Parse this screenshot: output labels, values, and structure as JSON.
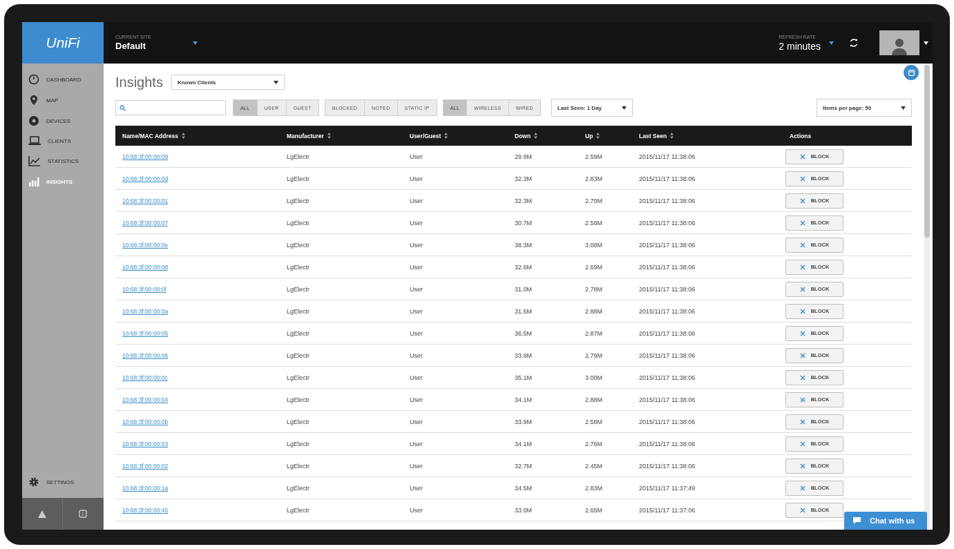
{
  "logo": {
    "text": "UniFi"
  },
  "header": {
    "site_label": "CURRENT SITE",
    "site_value": "Default",
    "refresh_label": "REFRESH RATE",
    "refresh_value": "2 minutes"
  },
  "sidebar": {
    "items": [
      {
        "label": "DASHBOARD",
        "kind": "dashboard",
        "selected": false
      },
      {
        "label": "MAP",
        "kind": "map",
        "selected": false
      },
      {
        "label": "DEVICES",
        "kind": "devices",
        "selected": false
      },
      {
        "label": "CLIENTS",
        "kind": "clients",
        "selected": false
      },
      {
        "label": "STATISTICS",
        "kind": "statistics",
        "selected": false
      },
      {
        "label": "INSIGHTS",
        "kind": "insights",
        "selected": true
      }
    ],
    "settings": "SETTINGS"
  },
  "page": {
    "title": "Insights",
    "view_select": "Known Clients"
  },
  "filters": {
    "groups": [
      [
        {
          "label": "ALL",
          "selected": true
        },
        {
          "label": "USER",
          "selected": false
        },
        {
          "label": "GUEST",
          "selected": false
        }
      ],
      [
        {
          "label": "BLOCKED",
          "selected": false
        },
        {
          "label": "NOTED",
          "selected": false
        },
        {
          "label": "STATIC IP",
          "selected": false
        }
      ],
      [
        {
          "label": "ALL",
          "selected": true
        },
        {
          "label": "WIRELESS",
          "selected": false
        },
        {
          "label": "WIRED",
          "selected": false
        }
      ]
    ],
    "last_seen": "Last Seen: 1 Day",
    "per_page": "Items per page: 50"
  },
  "table": {
    "columns": [
      {
        "label": "Name/MAC Address",
        "sortable": true
      },
      {
        "label": "Manufacturer",
        "sortable": true
      },
      {
        "label": "User/Guest",
        "sortable": true
      },
      {
        "label": "Down",
        "sortable": true
      },
      {
        "label": "Up",
        "sortable": true
      },
      {
        "label": "Last Seen",
        "sortable": true
      },
      {
        "label": "Actions",
        "sortable": false
      }
    ],
    "rows": [
      {
        "mac": "10:68:3f:00:00:09",
        "manufacturer": "LgElectr",
        "type": "User",
        "down": "29.9M",
        "up": "2.59M",
        "last_seen": "2015/11/17 11:38:06",
        "action": "BLOCK"
      },
      {
        "mac": "10:68:3f:00:00:0d",
        "manufacturer": "LgElectr",
        "type": "User",
        "down": "32.3M",
        "up": "2.83M",
        "last_seen": "2015/11/17 11:38:06",
        "action": "BLOCK"
      },
      {
        "mac": "10:68:3f:00:00:01",
        "manufacturer": "LgElectr",
        "type": "User",
        "down": "32.3M",
        "up": "2.70M",
        "last_seen": "2015/11/17 11:38:06",
        "action": "BLOCK"
      },
      {
        "mac": "10:68:3f:00:00:07",
        "manufacturer": "LgElectr",
        "type": "User",
        "down": "30.7M",
        "up": "2.58M",
        "last_seen": "2015/11/17 11:38:06",
        "action": "BLOCK"
      },
      {
        "mac": "10:68:3f:00:00:0e",
        "manufacturer": "LgElectr",
        "type": "User",
        "down": "38.3M",
        "up": "3.08M",
        "last_seen": "2015/11/17 11:38:06",
        "action": "BLOCK"
      },
      {
        "mac": "10:68:3f:00:00:08",
        "manufacturer": "LgElectr",
        "type": "User",
        "down": "32.6M",
        "up": "2.69M",
        "last_seen": "2015/11/17 11:38:06",
        "action": "BLOCK"
      },
      {
        "mac": "10:68:3f:00:00:0f",
        "manufacturer": "LgElectr",
        "type": "User",
        "down": "31.0M",
        "up": "2.78M",
        "last_seen": "2015/11/17 11:38:06",
        "action": "BLOCK"
      },
      {
        "mac": "10:68:3f:00:00:0a",
        "manufacturer": "LgElectr",
        "type": "User",
        "down": "31.5M",
        "up": "2.88M",
        "last_seen": "2015/11/17 11:38:06",
        "action": "BLOCK"
      },
      {
        "mac": "10:68:3f:00:00:05",
        "manufacturer": "LgElectr",
        "type": "User",
        "down": "36.5M",
        "up": "2.87M",
        "last_seen": "2015/11/17 11:38:06",
        "action": "BLOCK"
      },
      {
        "mac": "10:68:3f:00:00:06",
        "manufacturer": "LgElectr",
        "type": "User",
        "down": "33.9M",
        "up": "2.79M",
        "last_seen": "2015/11/17 11:38:06",
        "action": "BLOCK"
      },
      {
        "mac": "10:68:3f:00:00:0c",
        "manufacturer": "LgElectr",
        "type": "User",
        "down": "35.1M",
        "up": "3.00M",
        "last_seen": "2015/11/17 11:38:06",
        "action": "BLOCK"
      },
      {
        "mac": "10:68:3f:00:00:04",
        "manufacturer": "LgElectr",
        "type": "User",
        "down": "34.1M",
        "up": "2.88M",
        "last_seen": "2015/11/17 11:38:06",
        "action": "BLOCK"
      },
      {
        "mac": "10:68:3f:00:00:0b",
        "manufacturer": "LgElectr",
        "type": "User",
        "down": "33.9M",
        "up": "2.58M",
        "last_seen": "2015/11/17 11:38:06",
        "action": "BLOCK"
      },
      {
        "mac": "10:68:3f:00:00:03",
        "manufacturer": "LgElectr",
        "type": "User",
        "down": "34.1M",
        "up": "2.76M",
        "last_seen": "2015/11/17 11:38:06",
        "action": "BLOCK"
      },
      {
        "mac": "10:68:3f:00:00:02",
        "manufacturer": "LgElectr",
        "type": "User",
        "down": "32.7M",
        "up": "2.45M",
        "last_seen": "2015/11/17 11:38:06",
        "action": "BLOCK"
      },
      {
        "mac": "10:68:3f:00:00:1a",
        "manufacturer": "LgElectr",
        "type": "User",
        "down": "34.5M",
        "up": "2.83M",
        "last_seen": "2015/11/17 11:37:49",
        "action": "BLOCK"
      },
      {
        "mac": "10:68:3f:00:00:45",
        "manufacturer": "LgElectr",
        "type": "User",
        "down": "33.0M",
        "up": "2.65M",
        "last_seen": "2015/11/17 11:37:06",
        "action": "BLOCK"
      }
    ]
  },
  "chat": {
    "label": "Chat with us"
  }
}
